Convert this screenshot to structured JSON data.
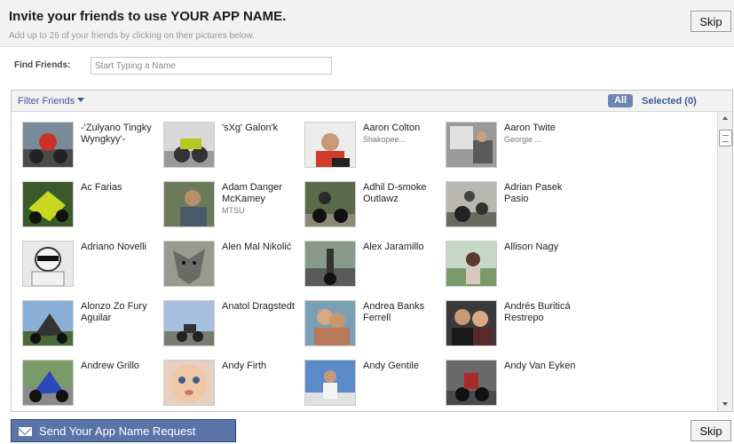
{
  "header": {
    "title": "Invite your friends to use YOUR APP NAME.",
    "subtitle": "Add up to 26 of your friends by clicking on their pictures below."
  },
  "buttons": {
    "skip_top": "Skip",
    "skip_bottom": "Skip",
    "send": "Send Your App Name Request"
  },
  "find": {
    "label": "Find Friends:",
    "placeholder": "Start Typing a Name"
  },
  "filter": {
    "filter_label": "Filter Friends",
    "all_label": "All",
    "selected_label": "Selected (0)"
  },
  "friends": [
    {
      "name": "-'Zulyano Tingky Wyngkyy'-",
      "sub": ""
    },
    {
      "name": "'sXg' Galon'k",
      "sub": ""
    },
    {
      "name": "Aaron Colton",
      "sub": "Shakopee..."
    },
    {
      "name": "Aaron Twite",
      "sub": "Georgie ..."
    },
    {
      "name": "Ac Farias",
      "sub": ""
    },
    {
      "name": "Adam Danger McKamey",
      "sub": "MTSU"
    },
    {
      "name": "Adhil D-smoke Outlawz",
      "sub": ""
    },
    {
      "name": "Adrian Pasek Pasio",
      "sub": ""
    },
    {
      "name": "Adriano Novelli",
      "sub": ""
    },
    {
      "name": "Alen Mal Nikolić",
      "sub": ""
    },
    {
      "name": "Alex Jaramillo",
      "sub": ""
    },
    {
      "name": "Allison Nagy",
      "sub": ""
    },
    {
      "name": "Alonzo Zo Fury Aguilar",
      "sub": ""
    },
    {
      "name": "Anatol Dragstedt",
      "sub": ""
    },
    {
      "name": "Andrea Banks Ferrell",
      "sub": ""
    },
    {
      "name": "Andrés Buriticá Restrepo",
      "sub": ""
    },
    {
      "name": "Andrew Grillo",
      "sub": ""
    },
    {
      "name": "Andy Firth",
      "sub": ""
    },
    {
      "name": "Andy Gentile",
      "sub": ""
    },
    {
      "name": "Andy Van Eyken",
      "sub": ""
    }
  ],
  "colors": {
    "link": "#3b5998",
    "button_primary": "#5b74a8",
    "all_tab": "#6d84b4"
  }
}
